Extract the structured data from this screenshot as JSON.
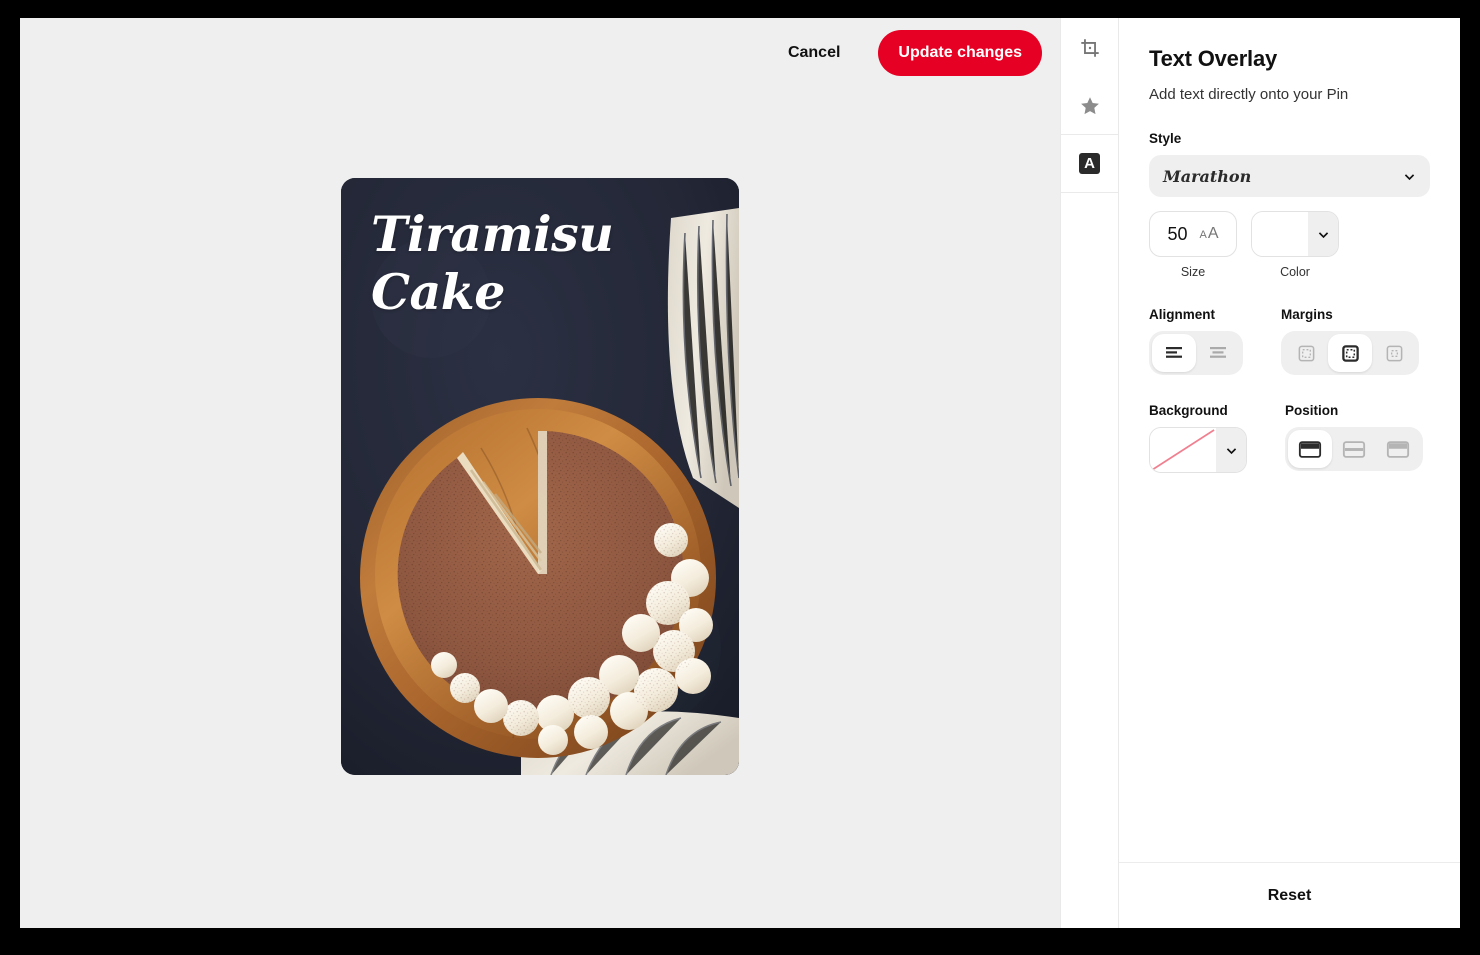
{
  "topbar": {
    "cancel_label": "Cancel",
    "update_label": "Update changes"
  },
  "pin_preview": {
    "overlay_text": "Tiramisu\nCake",
    "overlay_text_color": "#ffffff",
    "image_alt": "Tiramisu cake on a wooden board with dark background and striped cloth"
  },
  "rail": {
    "tabs": [
      {
        "name": "crop",
        "icon": "crop-icon",
        "selected": false
      },
      {
        "name": "highlight",
        "icon": "star-icon",
        "selected": false
      },
      {
        "name": "text-overlay",
        "icon": "text-a-icon",
        "label": "A",
        "selected": true
      }
    ]
  },
  "panel": {
    "title": "Text Overlay",
    "subtitle": "Add text directly onto your Pin",
    "style": {
      "label": "Style",
      "value": "Marathon"
    },
    "size": {
      "label": "Size",
      "value": "50"
    },
    "color": {
      "label": "Color",
      "value": "#ffffff"
    },
    "alignment": {
      "label": "Alignment",
      "options": [
        {
          "name": "align-left",
          "selected": true
        },
        {
          "name": "align-center",
          "selected": false
        }
      ]
    },
    "margins": {
      "label": "Margins",
      "options": [
        {
          "name": "margin-small",
          "selected": false
        },
        {
          "name": "margin-medium",
          "selected": true
        },
        {
          "name": "margin-large",
          "selected": false
        }
      ]
    },
    "background": {
      "label": "Background",
      "value": "none"
    },
    "position": {
      "label": "Position",
      "options": [
        {
          "name": "position-top",
          "selected": true
        },
        {
          "name": "position-middle",
          "selected": false
        },
        {
          "name": "position-bottom",
          "selected": false
        }
      ]
    },
    "reset_label": "Reset"
  },
  "colors": {
    "accent": "#e60023",
    "canvas_bg": "#efefef",
    "panel_bg": "#ffffff",
    "photo_bg": "#232736"
  }
}
